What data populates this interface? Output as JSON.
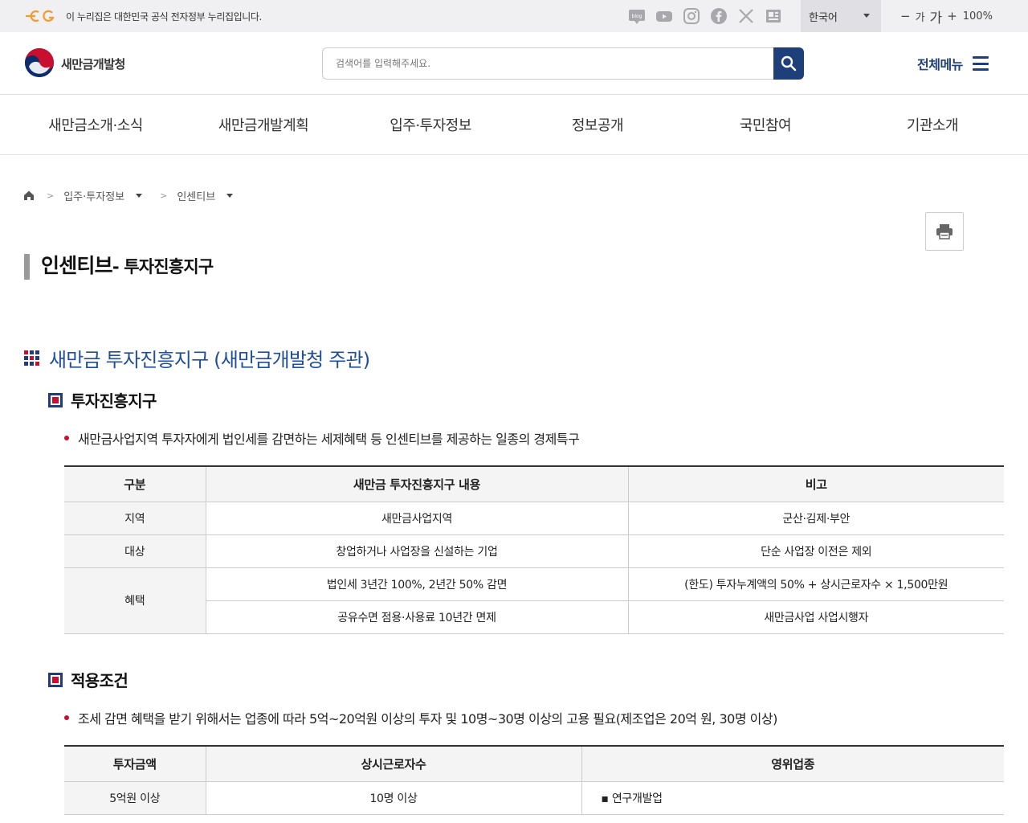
{
  "topbar": {
    "notice": "이 누리집은 대한민국 공식 전자정부 누리집입니다.",
    "sns": [
      "blog-icon",
      "youtube-icon",
      "instagram-icon",
      "facebook-icon",
      "x-icon",
      "news-icon"
    ],
    "language": "한국어",
    "zoom_out": "−",
    "font_small": "가",
    "font_large": "가",
    "zoom_in": "+",
    "zoom_level": "100%"
  },
  "header": {
    "logo_text": "새만금개발청",
    "search_placeholder": "검색어를 입력해주세요.",
    "all_menu": "전체메뉴",
    "accent_color": "#1f3f7a"
  },
  "gnb": {
    "items": [
      "새만금소개·소식",
      "새만금개발계획",
      "입주·투자정보",
      "정보공개",
      "국민참여",
      "기관소개"
    ]
  },
  "breadcrumb": {
    "level1": "입주·투자정보",
    "level2": "인센티브"
  },
  "page": {
    "title": "인센티브",
    "subtitle": "- 투자진흥지구",
    "section_title": "새만금 투자진흥지구 (새만금개발청 주관)"
  },
  "section1": {
    "heading": "투자진흥지구",
    "bullet": "새만금사업지역 투자자에게 법인세를 감면하는 세제혜택 등 인센티브를 제공하는 일종의 경제특구",
    "table": {
      "headers": [
        "구분",
        "새만금 투자진흥지구 내용",
        "비고"
      ],
      "rows": [
        {
          "cat": "지역",
          "content": "새만금사업지역",
          "note": "군산·김제·부안"
        },
        {
          "cat": "대상",
          "content": "창업하거나 사업장을 신설하는 기업",
          "note": "단순 사업장 이전은 제외"
        },
        {
          "cat": "혜택",
          "content": "법인세 3년간 100%, 2년간 50% 감면",
          "note": "(한도) 투자누계액의 50% + 상시근로자수 × 1,500만원"
        },
        {
          "cat": "",
          "content": "공유수면 점용·사용료 10년간 면제",
          "note": "새만금사업 사업시행자"
        }
      ]
    }
  },
  "section2": {
    "heading": "적용조건",
    "bullet": "조세 감면 혜택을 받기 위해서는 업종에 따라 5억~20억원 이상의 투자 및 10명~30명 이상의 고용 필요(제조업은 20억 원, 30명 이상)",
    "table": {
      "headers": [
        "투자금액",
        "상시근로자수",
        "영위업종"
      ],
      "rows": [
        {
          "amount": "5억원 이상",
          "workers": "10명 이상",
          "industry": "▪ 연구개발업"
        }
      ]
    }
  }
}
